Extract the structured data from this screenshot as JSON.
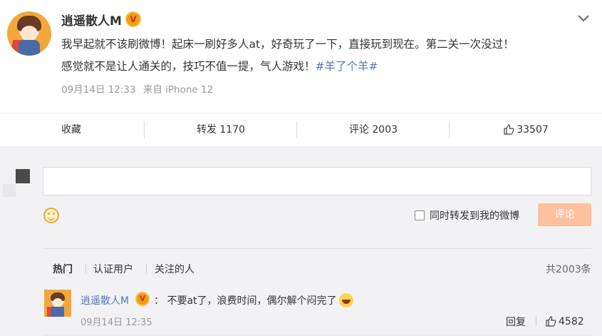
{
  "post": {
    "username": "逍遥散人M",
    "verified_badge": "V",
    "text_part1": "我早起就不该刷微博！起床一刷好多人at，好奇玩了一下，直接玩到现在。第二关一次没过！",
    "text_part2": "感觉就不是让人通关的，技巧不值一提，气人游戏！",
    "hashtag": "#羊了个羊#",
    "date": "09月14日 12:33",
    "source": "来自 iPhone 12",
    "menu_icon": "chevron-down-icon"
  },
  "actions": {
    "favorite_label": "收藏",
    "repost_label": "转发 1170",
    "comment_label": "评论 2003",
    "like_count": "33507",
    "like_icon": "thumbs-up-icon"
  },
  "composer": {
    "input_placeholder": "",
    "emoji_icon": "smiley-icon",
    "also_repost_label": "同时转发到我的微博",
    "submit_label": "评论"
  },
  "filters": {
    "hot": "热门",
    "verified": "认证用户",
    "following": "关注的人",
    "total": "共2003条"
  },
  "comments": [
    {
      "username": "逍遥散人M",
      "separator": "：",
      "text": "不要at了，浪费时间，偶尔解个闷完了",
      "emoji": "laughing-tears-icon",
      "time": "09月14日 12:35",
      "reply_label": "回复",
      "like_count": "4582"
    }
  ],
  "colors": {
    "link_blue": "#5177b5",
    "submit_orange": "#ffc09f",
    "badge_orange": "#f39c12"
  }
}
